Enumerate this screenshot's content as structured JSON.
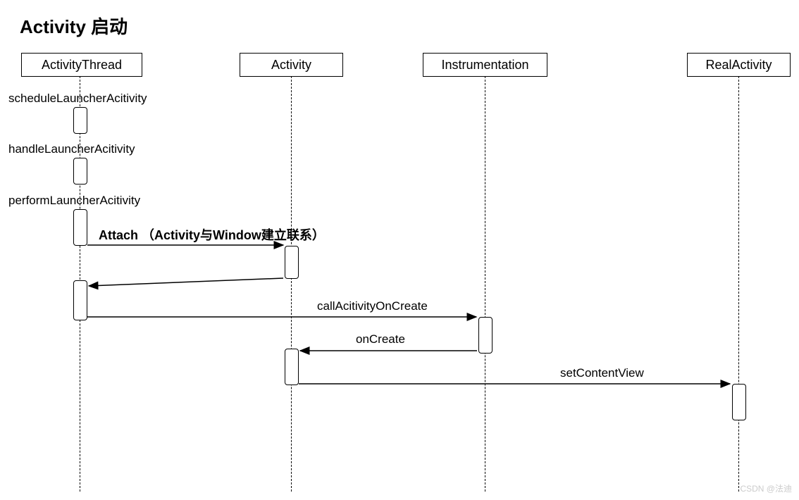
{
  "title": "Activity 启动",
  "participants": {
    "p1": "ActivityThread",
    "p2": "Activity",
    "p3": "Instrumentation",
    "p4": "RealActivity"
  },
  "messages": {
    "m1": "scheduleLauncherAcitivity",
    "m2": "handleLauncherAcitivity",
    "m3": "performLauncherAcitivity",
    "m4": "Attach （Activity与Window建立联系）",
    "m5": "callAcitivityOnCreate",
    "m6": "onCreate",
    "m7": "setContentView"
  },
  "watermark": "CSDN @法迪",
  "chart_data": {
    "type": "sequence-diagram",
    "title": "Activity 启动",
    "participants": [
      "ActivityThread",
      "Activity",
      "Instrumentation",
      "RealActivity"
    ],
    "messages": [
      {
        "from": "ActivityThread",
        "to": "ActivityThread",
        "label": "scheduleLauncherAcitivity",
        "kind": "self"
      },
      {
        "from": "ActivityThread",
        "to": "ActivityThread",
        "label": "handleLauncherAcitivity",
        "kind": "self"
      },
      {
        "from": "ActivityThread",
        "to": "ActivityThread",
        "label": "performLauncherAcitivity",
        "kind": "self"
      },
      {
        "from": "ActivityThread",
        "to": "Activity",
        "label": "Attach （Activity与Window建立联系）",
        "kind": "call"
      },
      {
        "from": "Activity",
        "to": "ActivityThread",
        "label": "",
        "kind": "return"
      },
      {
        "from": "ActivityThread",
        "to": "Instrumentation",
        "label": "callAcitivityOnCreate",
        "kind": "call"
      },
      {
        "from": "Instrumentation",
        "to": "Activity",
        "label": "onCreate",
        "kind": "call"
      },
      {
        "from": "Activity",
        "to": "RealActivity",
        "label": "setContentView",
        "kind": "call"
      }
    ]
  }
}
